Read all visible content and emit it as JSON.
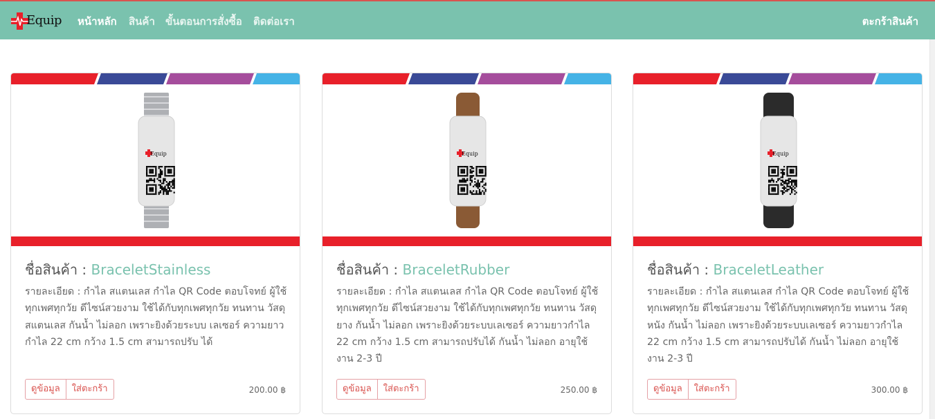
{
  "brand": {
    "name": "Equip"
  },
  "nav": {
    "items": [
      {
        "label": "หน้าหลัก",
        "active": true
      },
      {
        "label": "สินค้า",
        "active": false
      },
      {
        "label": "ขั้นตอนการสั่งซื้อ",
        "active": false
      },
      {
        "label": "ติดต่อเรา",
        "active": false
      }
    ],
    "cart_label": "ตะกร้าสินค้า"
  },
  "colors": {
    "navbar": "#7ac2ae",
    "accent_red": "#e8202a",
    "stripe_blue_dark": "#3a4a97",
    "stripe_purple": "#a54d9c",
    "stripe_blue_light": "#45b3e6",
    "product_name": "#7ac2ae"
  },
  "products": [
    {
      "title_prefix": "ชื่อสินค้า : ",
      "name": "BraceletStainless",
      "description": "รายละเอียด : กำไล สแตนเลส กำไล QR Code ตอบโจทย์ ผู้ใช้ทุกเพศทุกวัย ดีไซน์สวยงาม ใช้ได้กับทุกเพศทุกวัย ทนทาน วัสดุ สแตนเลส กันน้ำ ไม่ลอก เพราะยิงด้วยระบบ เลเซอร์ ความยาวกำไล 22 cm กว้าง 1.5 cm สามารถปรับ ได้",
      "detail_button": "ดูข้อมูล",
      "cart_button": "ใส่ตะกร้า",
      "price": "200.00 ฿",
      "strap": "stainless",
      "tag_text": "Equip"
    },
    {
      "title_prefix": "ชื่อสินค้า : ",
      "name": "BraceletRubber",
      "description": "รายละเอียด : กำไล สแตนเลส กำไล QR Code ตอบโจทย์ ผู้ใช้ทุกเพศทุกวัย ดีไซน์สวยงาม ใช้ได้กับทุกเพศทุกวัย ทนทาน วัสดุ ยาง กันน้ำ ไม่ลอก เพราะยิงด้วยระบบเลเซอร์ ความยาวกำไล 22 cm กว้าง 1.5 cm สามารถปรับได้ กันน้ำ ไม่ลอก อายุใช้งาน 2-3 ปี",
      "detail_button": "ดูข้อมูล",
      "cart_button": "ใส่ตะกร้า",
      "price": "250.00 ฿",
      "strap": "rubber",
      "tag_text": "Equip"
    },
    {
      "title_prefix": "ชื่อสินค้า : ",
      "name": "BraceletLeather",
      "description": "รายละเอียด : กำไล สแตนเลส กำไล QR Code ตอบโจทย์ ผู้ใช้ทุกเพศทุกวัย ดีไซน์สวยงาม ใช้ได้กับทุกเพศทุกวัย ทนทาน วัสดุ หนัง กันน้ำ ไม่ลอก เพราะยิงด้วยระบบเลเซอร์ ความยาวกำไล 22 cm กว้าง 1.5 cm สามารถปรับได้ กันน้ำ ไม่ลอก อายุใช้งาน 2-3 ปี",
      "detail_button": "ดูข้อมูล",
      "cart_button": "ใส่ตะกร้า",
      "price": "300.00 ฿",
      "strap": "leather",
      "tag_text": "Equip"
    }
  ]
}
